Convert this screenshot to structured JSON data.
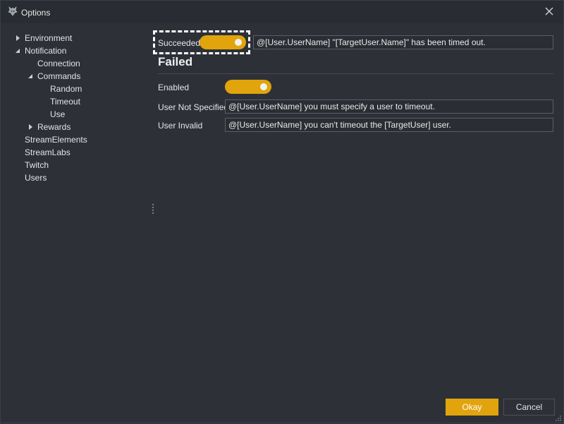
{
  "window": {
    "title": "Options",
    "icon": "dragon-shield-icon",
    "close_icon": "close-icon"
  },
  "tree": {
    "items": [
      {
        "label": "Environment",
        "level": 1,
        "expander": "collapsed"
      },
      {
        "label": "Notification",
        "level": 1,
        "expander": "expanded"
      },
      {
        "label": "Connection",
        "level": 2,
        "expander": "none"
      },
      {
        "label": "Commands",
        "level": 2,
        "expander": "expanded"
      },
      {
        "label": "Random",
        "level": 3,
        "expander": "none"
      },
      {
        "label": "Timeout",
        "level": 3,
        "expander": "none"
      },
      {
        "label": "Use",
        "level": 3,
        "expander": "none"
      },
      {
        "label": "Rewards",
        "level": 2,
        "expander": "collapsed"
      },
      {
        "label": "StreamElements",
        "level": 1,
        "expander": "none"
      },
      {
        "label": "StreamLabs",
        "level": 1,
        "expander": "none"
      },
      {
        "label": "Twitch",
        "level": 1,
        "expander": "none"
      },
      {
        "label": "Users",
        "level": 1,
        "expander": "none"
      }
    ]
  },
  "succeeded": {
    "label": "Succeeded",
    "toggle_on": true,
    "message": "@[User.UserName] \"[TargetUser.Name]\" has been timed out."
  },
  "failed": {
    "title": "Failed",
    "enabled_label": "Enabled",
    "enabled_on": true,
    "user_not_specified_label": "User Not Specified",
    "user_not_specified_message": "@[User.UserName] you must specify a user to timeout.",
    "user_invalid_label": "User Invalid",
    "user_invalid_message": "@[User.UserName] you can't timeout the [TargetUser] user."
  },
  "buttons": {
    "okay": "Okay",
    "cancel": "Cancel"
  },
  "colors": {
    "accent": "#e1a40c",
    "background": "#2e3038",
    "field_border": "#5b5e66"
  }
}
